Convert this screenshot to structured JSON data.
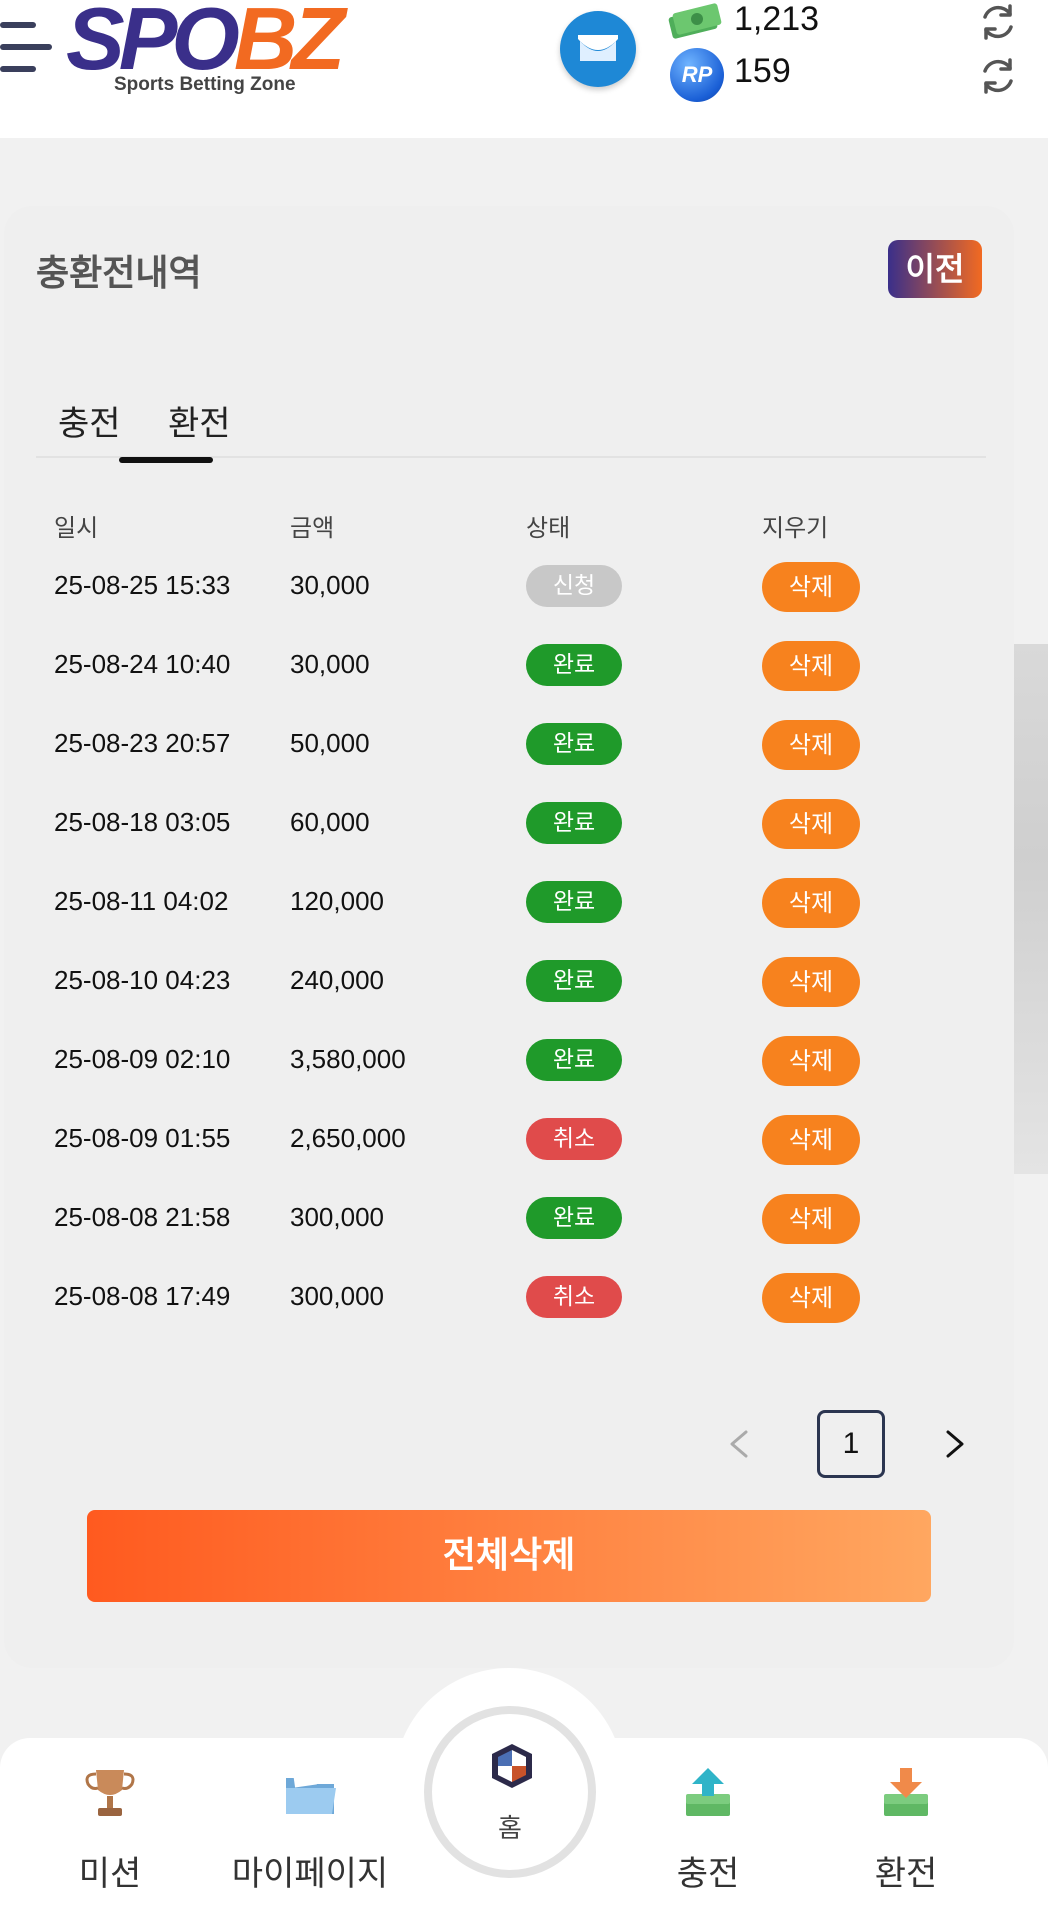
{
  "header": {
    "logo_main_1": "SPO",
    "logo_main_2": "BZ",
    "logo_sub": "Sports Betting Zone",
    "money_balance": "1,213",
    "rp_label": "RP",
    "rp_balance": "159"
  },
  "card": {
    "title": "충환전내역",
    "prev_button": "이전",
    "tabs": {
      "charge": "충전",
      "exchange": "환전",
      "active": "exchange"
    },
    "columns": [
      "일시",
      "금액",
      "상태",
      "지우기"
    ],
    "rows": [
      {
        "date": "25-08-25 15:33",
        "amount": "30,000",
        "status": "신청",
        "status_color": "#c8c8c8",
        "delete": "삭제"
      },
      {
        "date": "25-08-24 10:40",
        "amount": "30,000",
        "status": "완료",
        "status_color": "#1f9a2a",
        "delete": "삭제"
      },
      {
        "date": "25-08-23 20:57",
        "amount": "50,000",
        "status": "완료",
        "status_color": "#1f9a2a",
        "delete": "삭제"
      },
      {
        "date": "25-08-18 03:05",
        "amount": "60,000",
        "status": "완료",
        "status_color": "#1f9a2a",
        "delete": "삭제"
      },
      {
        "date": "25-08-11 04:02",
        "amount": "120,000",
        "status": "완료",
        "status_color": "#1f9a2a",
        "delete": "삭제"
      },
      {
        "date": "25-08-10 04:23",
        "amount": "240,000",
        "status": "완료",
        "status_color": "#1f9a2a",
        "delete": "삭제"
      },
      {
        "date": "25-08-09 02:10",
        "amount": "3,580,000",
        "status": "완료",
        "status_color": "#1f9a2a",
        "delete": "삭제"
      },
      {
        "date": "25-08-09 01:55",
        "amount": "2,650,000",
        "status": "취소",
        "status_color": "#e04b4b",
        "delete": "삭제"
      },
      {
        "date": "25-08-08 21:58",
        "amount": "300,000",
        "status": "완료",
        "status_color": "#1f9a2a",
        "delete": "삭제"
      },
      {
        "date": "25-08-08 17:49",
        "amount": "300,000",
        "status": "취소",
        "status_color": "#e04b4b",
        "delete": "삭제"
      }
    ],
    "pagination": {
      "current_page": "1"
    },
    "delete_all_button": "전체삭제"
  },
  "bottom_nav": {
    "mission": "미션",
    "mypage": "마이페이지",
    "home": "홈",
    "charge": "충전",
    "exchange": "환전"
  },
  "colors": {
    "brand_purple": "#3a2f8a",
    "brand_orange": "#f26a21",
    "delete_orange": "#f7821e"
  }
}
